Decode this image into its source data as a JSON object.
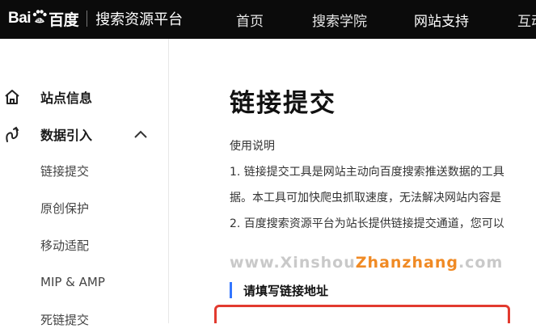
{
  "header": {
    "brand_left": "Bai",
    "brand_right": "百度",
    "platform_title": "搜索资源平台",
    "nav": [
      {
        "label": "首页"
      },
      {
        "label": "搜索学院"
      },
      {
        "label": "网站支持"
      },
      {
        "label": "互动"
      }
    ]
  },
  "sidebar": {
    "items": [
      {
        "label": "站点信息",
        "icon": "home-icon"
      },
      {
        "label": "数据引入",
        "icon": "data-import-icon",
        "expanded": true
      }
    ],
    "sub_items": [
      {
        "label": "链接提交"
      },
      {
        "label": "原创保护"
      },
      {
        "label": "移动适配"
      },
      {
        "label": "MIP & AMP"
      },
      {
        "label": "死链提交"
      }
    ]
  },
  "main": {
    "title": "链接提交",
    "usage_heading": "使用说明",
    "lines": [
      "1. 链接提交工具是网站主动向百度搜索推送数据的工具",
      "据。本工具可加快爬虫抓取速度，无法解决网站内容是",
      "2. 百度搜索资源平台为站长提供链接提交通道，您可以"
    ],
    "watermark_prefix": "www.Xinshou",
    "watermark_accent": "Zhanzhang",
    "watermark_suffix": ".com",
    "section_label": "请填写链接地址"
  },
  "colors": {
    "topbar": "#0b0b0b",
    "accent_blue": "#3376ff",
    "highlight_red": "#e23a2f",
    "watermark_orange": "#f08a24"
  }
}
